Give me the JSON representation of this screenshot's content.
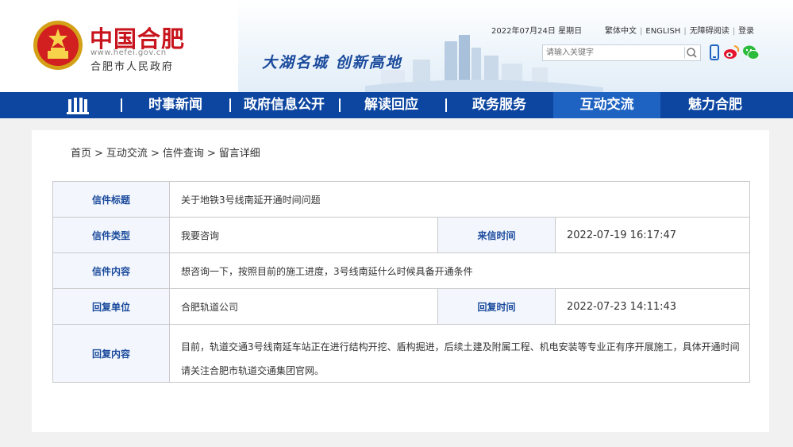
{
  "site": {
    "name": "中国合肥",
    "url": "www.hefei.gov.cn",
    "subname": "合肥市人民政府",
    "slogan": "大湖名城  创新高地",
    "date": "2022年07月24日 星期日"
  },
  "toplinks": [
    "繁体中文",
    "ENGLISH",
    "无障碍阅读",
    "登录"
  ],
  "search": {
    "placeholder": "请输入关键字"
  },
  "nav": {
    "items": [
      "时事新闻",
      "政府信息公开",
      "解读回应",
      "政务服务",
      "互动交流",
      "魅力合肥"
    ],
    "active": "互动交流"
  },
  "breadcrumb": [
    "首页",
    "互动交流",
    "信件查询",
    "留言详细"
  ],
  "letter": {
    "title_label": "信件标题",
    "title": "关于地铁3号线南延开通时间问题",
    "type_label": "信件类型",
    "type": "我要咨询",
    "time_label": "来信时间",
    "time": "2022-07-19 16:17:47",
    "content_label": "信件内容",
    "content": "想咨询一下，按照目前的施工进度，3号线南延什么时候具备开通条件",
    "reply_unit_label": "回复单位",
    "reply_unit": "合肥轨道公司",
    "reply_time_label": "回复时间",
    "reply_time": "2022-07-23 14:11:43",
    "reply_content_label": "回复内容",
    "reply_content": "目前，轨道交通3号线南延车站正在进行结构开挖、盾构掘进，后续土建及附属工程、机电安装等专业正有序开展施工，具体开通时间请关注合肥市轨道交通集团官网。"
  },
  "colors": {
    "nav": "#0d46a0",
    "nav_active": "#1e63c2",
    "brand_red": "#c8141c",
    "label_blue": "#1a4a9c"
  }
}
